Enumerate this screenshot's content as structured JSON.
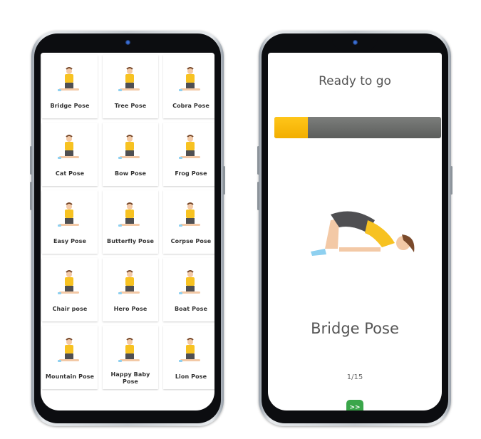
{
  "left_screen": {
    "poses": [
      {
        "label": "Bridge Pose",
        "icon": "bridge-pose-figure"
      },
      {
        "label": "Tree Pose",
        "icon": "tree-pose-figure"
      },
      {
        "label": "Cobra Pose",
        "icon": "cobra-pose-figure"
      },
      {
        "label": "Cat Pose",
        "icon": "cat-pose-figure"
      },
      {
        "label": "Bow Pose",
        "icon": "bow-pose-figure"
      },
      {
        "label": "Frog Pose",
        "icon": "frog-pose-figure"
      },
      {
        "label": "Easy Pose",
        "icon": "easy-pose-figure"
      },
      {
        "label": "Butterfly Pose",
        "icon": "butterfly-pose-figure"
      },
      {
        "label": "Corpse Pose",
        "icon": "corpse-pose-figure"
      },
      {
        "label": "Chair pose",
        "icon": "chair-pose-figure"
      },
      {
        "label": "Hero Pose",
        "icon": "hero-pose-figure"
      },
      {
        "label": "Boat Pose",
        "icon": "boat-pose-figure"
      },
      {
        "label": "Mountain Pose",
        "icon": "mountain-pose-figure"
      },
      {
        "label": "Happy Baby Pose",
        "icon": "happy-baby-pose-figure"
      },
      {
        "label": "Lion Pose",
        "icon": "lion-pose-figure"
      }
    ]
  },
  "right_screen": {
    "title": "Ready to go",
    "progress": 0.2,
    "pose_name": "Bridge Pose",
    "counter": "1/15",
    "next_label": ">>",
    "colors": {
      "progress_fill": "#ffc107",
      "progress_track": "#6b6d6b",
      "next_button": "#3aa64a"
    }
  }
}
